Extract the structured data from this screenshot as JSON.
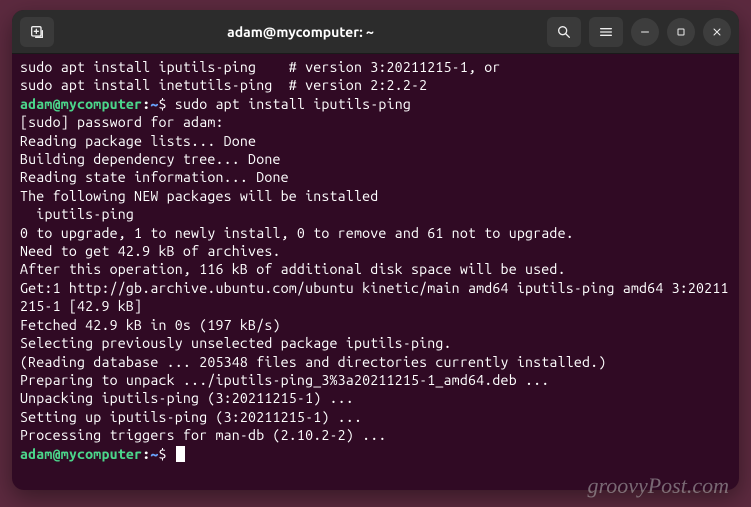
{
  "window": {
    "title": "adam@mycomputer: ~"
  },
  "titlebar": {
    "new_tab_icon": "new-tab",
    "search_icon": "search",
    "menu_icon": "hamburger",
    "minimize_icon": "minimize",
    "maximize_icon": "maximize",
    "close_icon": "close"
  },
  "prompt": {
    "user_host": "adam@mycomputer",
    "colon": ":",
    "path": "~",
    "symbol": "$"
  },
  "lines": [
    "sudo apt install iputils-ping    # version 3:20211215-1, or",
    "sudo apt install inetutils-ping  # version 2:2.2-2",
    {
      "type": "prompt",
      "cmd": "sudo apt install iputils-ping"
    },
    "[sudo] password for adam:",
    "Reading package lists... Done",
    "Building dependency tree... Done",
    "Reading state information... Done",
    "The following NEW packages will be installed",
    "  iputils-ping",
    "0 to upgrade, 1 to newly install, 0 to remove and 61 not to upgrade.",
    "Need to get 42.9 kB of archives.",
    "After this operation, 116 kB of additional disk space will be used.",
    "Get:1 http://gb.archive.ubuntu.com/ubuntu kinetic/main amd64 iputils-ping amd64 3:20211215-1 [42.9 kB]",
    "Fetched 42.9 kB in 0s (197 kB/s)",
    "Selecting previously unselected package iputils-ping.",
    "(Reading database ... 205348 files and directories currently installed.)",
    "Preparing to unpack .../iputils-ping_3%3a20211215-1_amd64.deb ...",
    "Unpacking iputils-ping (3:20211215-1) ...",
    "Setting up iputils-ping (3:20211215-1) ...",
    "Processing triggers for man-db (2.10.2-2) ...",
    {
      "type": "prompt",
      "cmd": "",
      "cursor": true
    }
  ],
  "watermark": "groovyPost.com"
}
